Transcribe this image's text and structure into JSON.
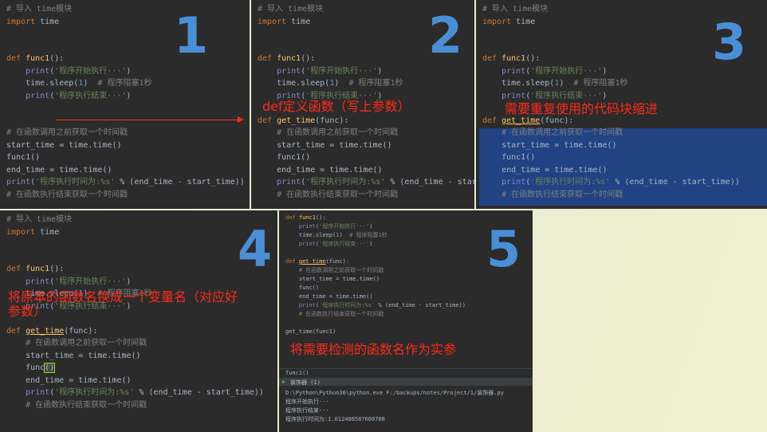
{
  "panels": {
    "p1": {
      "number": "1",
      "lines": [
        [
          [
            "cm",
            "# 导入 time模块"
          ]
        ],
        [
          [
            "kw",
            "import"
          ],
          [
            "t",
            " time"
          ]
        ],
        [],
        [],
        [
          [
            "kw",
            "def "
          ],
          [
            "fn",
            "func1"
          ],
          [
            "t",
            "():"
          ]
        ],
        [
          [
            "t",
            "    "
          ],
          [
            "pr",
            "print"
          ],
          [
            "t",
            "("
          ],
          [
            "str",
            "'程序开始执行···'"
          ],
          [
            "t",
            ")"
          ]
        ],
        [
          [
            "t",
            "    time.sleep("
          ],
          [
            "num",
            "1"
          ],
          [
            "t",
            ")  "
          ],
          [
            "cm",
            "# 程序阻塞1秒"
          ]
        ],
        [
          [
            "t",
            "    "
          ],
          [
            "pr",
            "print"
          ],
          [
            "t",
            "("
          ],
          [
            "str",
            "'程序执行结束···'"
          ],
          [
            "t",
            ")"
          ]
        ],
        [],
        [],
        [
          [
            "cm",
            "# 在函数调用之前获取一个时间戳"
          ]
        ],
        [
          [
            "t",
            "start_time = time.time()"
          ]
        ],
        [
          [
            "t",
            "func1()"
          ]
        ],
        [
          [
            "t",
            "end_time = time.time()"
          ]
        ],
        [
          [
            "pr",
            "print"
          ],
          [
            "t",
            "("
          ],
          [
            "str",
            "'程序执行时间为:%s'"
          ],
          [
            "t",
            " % (end_time - start_time))"
          ]
        ],
        [
          [
            "cm",
            "# 在函数执行结束获取一个时间戳"
          ]
        ]
      ]
    },
    "p2": {
      "number": "2",
      "annotation": "def定义函数（写上参数）",
      "lines": [
        [
          [
            "cm",
            "# 导入 time模块"
          ]
        ],
        [
          [
            "kw",
            "import"
          ],
          [
            "t",
            " time"
          ]
        ],
        [],
        [],
        [
          [
            "kw",
            "def "
          ],
          [
            "fn",
            "func1"
          ],
          [
            "t",
            "():"
          ]
        ],
        [
          [
            "t",
            "    "
          ],
          [
            "pr",
            "print"
          ],
          [
            "t",
            "("
          ],
          [
            "str",
            "'程序开始执行···'"
          ],
          [
            "t",
            ")"
          ]
        ],
        [
          [
            "t",
            "    time.sleep("
          ],
          [
            "num",
            "1"
          ],
          [
            "t",
            ")  "
          ],
          [
            "cm",
            "# 程序阻塞1秒"
          ]
        ],
        [
          [
            "t",
            "    "
          ],
          [
            "pr",
            "print"
          ],
          [
            "t",
            "("
          ],
          [
            "str",
            "'程序执行结束···'"
          ],
          [
            "t",
            ")"
          ]
        ],
        [],
        [
          [
            "kw",
            "def "
          ],
          [
            "fn",
            "get_time"
          ],
          [
            "t",
            "(func):"
          ]
        ],
        [
          [
            "t",
            "    "
          ],
          [
            "cm",
            "# 在函数调用之前获取一个时间戳"
          ]
        ],
        [
          [
            "t",
            "    start_time = time.time()"
          ]
        ],
        [
          [
            "t",
            "    func1()"
          ]
        ],
        [
          [
            "t",
            "    end_time = time.time()"
          ]
        ],
        [
          [
            "t",
            "    "
          ],
          [
            "pr",
            "print"
          ],
          [
            "t",
            "("
          ],
          [
            "str",
            "'程序执行时间为:%s'"
          ],
          [
            "t",
            " % (end_time - start_time))"
          ]
        ],
        [
          [
            "t",
            "    "
          ],
          [
            "cm",
            "# 在函数执行结束获取一个时间戳"
          ]
        ]
      ]
    },
    "p3": {
      "number": "3",
      "annotation": "需要重复使用的代码块缩进",
      "lines": [
        [
          [
            "cm",
            "# 导入 time模块"
          ]
        ],
        [
          [
            "kw",
            "import"
          ],
          [
            "t",
            " time"
          ]
        ],
        [],
        [],
        [
          [
            "kw",
            "def "
          ],
          [
            "fn",
            "func1"
          ],
          [
            "t",
            "():"
          ]
        ],
        [
          [
            "t",
            "    "
          ],
          [
            "pr",
            "print"
          ],
          [
            "t",
            "("
          ],
          [
            "str",
            "'程序开始执行···'"
          ],
          [
            "t",
            ")"
          ]
        ],
        [
          [
            "t",
            "    time.sleep("
          ],
          [
            "num",
            "1"
          ],
          [
            "t",
            ")  "
          ],
          [
            "cm",
            "# 程序阻塞1秒"
          ]
        ],
        [
          [
            "t",
            "    "
          ],
          [
            "pr",
            "print"
          ],
          [
            "t",
            "("
          ],
          [
            "str",
            "'程序执行结束···'"
          ],
          [
            "t",
            ")"
          ]
        ],
        [],
        [
          [
            "kw",
            "def "
          ],
          [
            "fn",
            "get_time"
          ],
          [
            "t",
            "(func):"
          ]
        ],
        [
          [
            "t",
            "    "
          ],
          [
            "cm",
            "# 在函数调用之前获取一个时间戳"
          ]
        ],
        [
          [
            "t",
            "    start_time = time.time()"
          ]
        ],
        [
          [
            "t",
            "    func1()"
          ]
        ],
        [
          [
            "t",
            "    end_time = time.time()"
          ]
        ],
        [
          [
            "t",
            "    "
          ],
          [
            "pr",
            "print"
          ],
          [
            "t",
            "("
          ],
          [
            "str",
            "'程序执行时间为:%s'"
          ],
          [
            "t",
            " % (end_time - start_time))"
          ]
        ],
        [
          [
            "t",
            "    "
          ],
          [
            "cm",
            "# 在函数执行结束获取一个时间戳"
          ]
        ]
      ]
    },
    "p4": {
      "number": "4",
      "annotation": "将原本的函数名换成一个变量名（对应好\n参数）",
      "lines": [
        [
          [
            "cm",
            "# 导入 time模块"
          ]
        ],
        [
          [
            "kw",
            "import"
          ],
          [
            "t",
            " time"
          ]
        ],
        [],
        [],
        [
          [
            "kw",
            "def "
          ],
          [
            "fn",
            "func1"
          ],
          [
            "t",
            "():"
          ]
        ],
        [
          [
            "t",
            "    "
          ],
          [
            "pr",
            "print"
          ],
          [
            "t",
            "("
          ],
          [
            "str",
            "'程序开始执行···'"
          ],
          [
            "t",
            ")"
          ]
        ],
        [
          [
            "t",
            "    time.sleep("
          ],
          [
            "num",
            "1"
          ],
          [
            "t",
            ")  "
          ],
          [
            "cm",
            "# 程序阻塞1秒"
          ]
        ],
        [
          [
            "t",
            "    "
          ],
          [
            "pr",
            "print"
          ],
          [
            "t",
            "("
          ],
          [
            "str",
            "'程序执行结束···'"
          ],
          [
            "t",
            ")"
          ]
        ],
        [],
        [
          [
            "kw",
            "def "
          ],
          [
            "fn",
            "get_time"
          ],
          [
            "t",
            "(func):"
          ]
        ],
        [
          [
            "t",
            "    "
          ],
          [
            "cm",
            "# 在函数调用之前获取一个时间戳"
          ]
        ],
        [
          [
            "t",
            "    start_time = time.time()"
          ]
        ],
        [
          [
            "t",
            "    func"
          ],
          [
            "caret",
            "()"
          ]
        ],
        [
          [
            "t",
            "    end_time = time.time()"
          ]
        ],
        [
          [
            "t",
            "    "
          ],
          [
            "pr",
            "print"
          ],
          [
            "t",
            "("
          ],
          [
            "str",
            "'程序执行时间为:%s'"
          ],
          [
            "t",
            " % (end_time - start_time))"
          ]
        ],
        [
          [
            "t",
            "    "
          ],
          [
            "cm",
            "# 在函数执行结束获取一个时间戳"
          ]
        ]
      ]
    },
    "p5": {
      "number": "5",
      "annotation": "将需要检测的函数名作为实参",
      "lines": [
        [
          [
            "kw",
            "def "
          ],
          [
            "fn",
            "func1"
          ],
          [
            "t",
            "():"
          ]
        ],
        [
          [
            "t",
            "    "
          ],
          [
            "pr",
            "print"
          ],
          [
            "t",
            "("
          ],
          [
            "str",
            "'程序开始执行···'"
          ],
          [
            "t",
            ")"
          ]
        ],
        [
          [
            "t",
            "    time.sleep("
          ],
          [
            "num",
            "1"
          ],
          [
            "t",
            ")  "
          ],
          [
            "cm",
            "# 程序阻塞1秒"
          ]
        ],
        [
          [
            "t",
            "    "
          ],
          [
            "pr",
            "print"
          ],
          [
            "t",
            "("
          ],
          [
            "str",
            "'程序执行结束···'"
          ],
          [
            "t",
            ")"
          ]
        ],
        [],
        [
          [
            "kw",
            "def "
          ],
          [
            "fn",
            "get_time"
          ],
          [
            "t",
            "(func):"
          ]
        ],
        [
          [
            "t",
            "    "
          ],
          [
            "cm",
            "# 在函数调用之前获取一个时间戳"
          ]
        ],
        [
          [
            "t",
            "    start_time = time.time()"
          ]
        ],
        [
          [
            "t",
            "    func()"
          ]
        ],
        [
          [
            "t",
            "    end_time = time.time()"
          ]
        ],
        [
          [
            "t",
            "    "
          ],
          [
            "pr",
            "print"
          ],
          [
            "t",
            "("
          ],
          [
            "str",
            "'程序执行时间为:%s'"
          ],
          [
            "t",
            " % (end_time - start_time))"
          ]
        ],
        [
          [
            "t",
            "    "
          ],
          [
            "cm",
            "# 在函数执行结束获取一个时间戳"
          ]
        ],
        [],
        [
          [
            "t",
            "get_time(func1)"
          ]
        ]
      ],
      "breadcrumb": "func1()",
      "run_tab": "装饰器 (1)",
      "console": [
        "D:\\Python\\Python36\\python.exe F:/backups/notes/Project/1/装饰器.py",
        "程序开始执行···",
        "程序执行结束···",
        "程序执行时间为:1.012486587600708"
      ]
    }
  },
  "colors": {
    "editor_bg": "#2b2b2b",
    "keyword": "#cc7832",
    "function": "#ffc66d",
    "string": "#6a8759",
    "comment": "#808080",
    "number_label": "#4a8fd6",
    "annotation": "#ff2a1a",
    "selection": "#214283"
  }
}
